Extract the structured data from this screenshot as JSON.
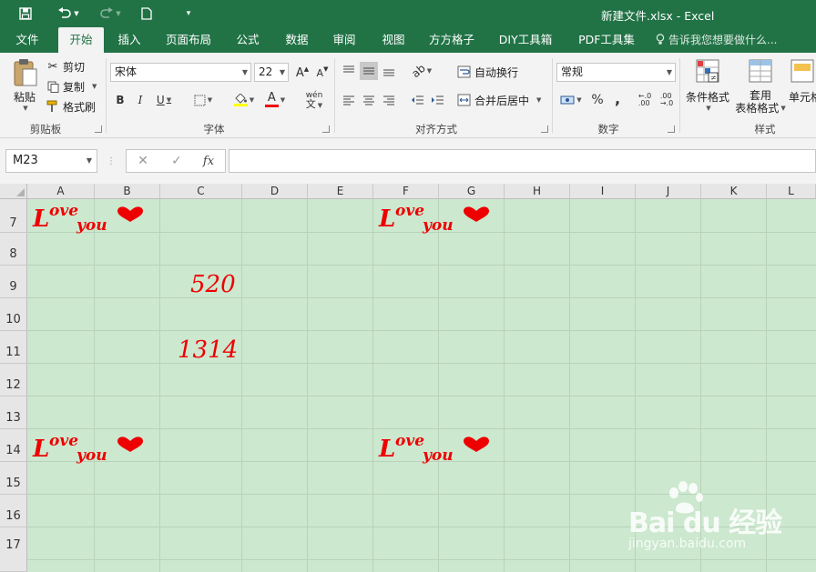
{
  "window": {
    "title": "新建文件.xlsx - Excel"
  },
  "qat": {
    "save_icon": "save-icon",
    "undo_icon": "undo-icon",
    "redo_icon": "redo-icon",
    "new_icon": "new-document-icon",
    "customize_icon": "customize-qat-icon"
  },
  "tabs": [
    {
      "label": "文件"
    },
    {
      "label": "开始",
      "active": true
    },
    {
      "label": "插入"
    },
    {
      "label": "页面布局"
    },
    {
      "label": "公式"
    },
    {
      "label": "数据"
    },
    {
      "label": "审阅"
    },
    {
      "label": "视图"
    },
    {
      "label": "方方格子"
    },
    {
      "label": "DIY工具箱"
    },
    {
      "label": "PDF工具集"
    }
  ],
  "tellme": "告诉我您想要做什么...",
  "ribbon": {
    "clipboard": {
      "label": "剪贴板",
      "paste": "粘贴",
      "cut": "剪切",
      "copy": "复制",
      "format_painter": "格式刷"
    },
    "font": {
      "label": "字体",
      "font_name": "宋体",
      "font_size": "22",
      "bold": "B",
      "italic": "I",
      "underline": "U",
      "grow": "A",
      "shrink": "A",
      "phonetic": "wén"
    },
    "alignment": {
      "label": "对齐方式",
      "wrap_text": "自动换行",
      "merge_center": "合并后居中"
    },
    "number": {
      "label": "数字",
      "format": "常规",
      "percent": "%",
      "comma": ","
    },
    "styles": {
      "label": "样式",
      "conditional": "条件格式",
      "table_format_1": "套用",
      "table_format_2": "表格格式",
      "cell_styles": "单元格"
    }
  },
  "formula_bar": {
    "name_box": "M23",
    "cancel": "✕",
    "enter": "✓",
    "fx": "fx",
    "content": ""
  },
  "sheet": {
    "columns": [
      "A",
      "B",
      "C",
      "D",
      "E",
      "F",
      "G",
      "H",
      "I",
      "J",
      "K",
      "L"
    ],
    "rows": [
      "7",
      "8",
      "9",
      "10",
      "11",
      "12",
      "13",
      "14",
      "15",
      "16",
      "17"
    ],
    "love_L": "L",
    "love_ove": "ove",
    "love_you": "you",
    "num_520": "520",
    "num_1314": "1314",
    "text_color": "#ee0000",
    "fill_color": "#cce8cf"
  },
  "watermark": {
    "brand": "Bai du 经验",
    "url": "jingyan.baidu.com"
  }
}
